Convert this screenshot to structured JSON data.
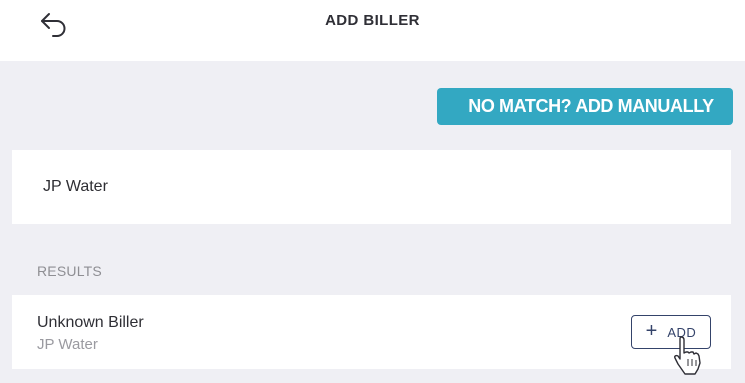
{
  "header": {
    "title": "ADD BILLER",
    "back_icon": "back-arrow-icon"
  },
  "actions": {
    "manual_add_label": "NO MATCH? ADD MANUALLY",
    "accent_color": "#33a8c2"
  },
  "search": {
    "value": "JP Water",
    "placeholder": ""
  },
  "results": {
    "heading": "RESULTS",
    "items": [
      {
        "name": "Unknown Biller",
        "subtitle": "JP Water",
        "add_label": "ADD",
        "add_icon": "plus-icon"
      }
    ]
  },
  "cursor_icon": "pointer-cursor-icon"
}
